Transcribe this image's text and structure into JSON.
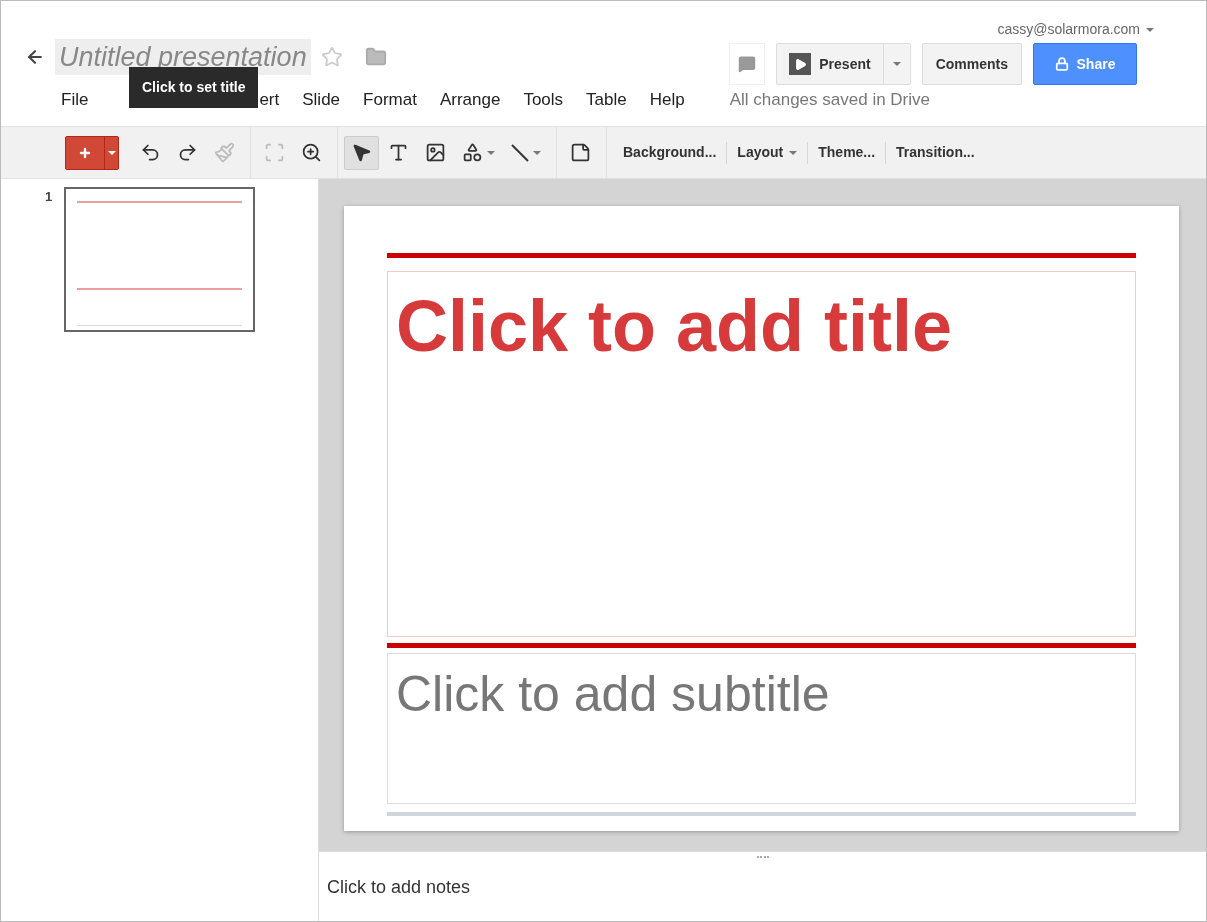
{
  "header": {
    "title": "Untitled presentation",
    "starred": false,
    "tooltip": "Click to set title",
    "account": "cassy@solarmora.com",
    "save_status": "All changes saved in Drive",
    "present": "Present",
    "comments": "Comments",
    "share": "Share"
  },
  "menu": [
    {
      "label": "File",
      "hidden_by_tooltip": false
    },
    {
      "label": "ert",
      "hidden_by_tooltip": true
    },
    {
      "label": "Slide",
      "hidden_by_tooltip": false
    },
    {
      "label": "Format",
      "hidden_by_tooltip": false
    },
    {
      "label": "Arrange",
      "hidden_by_tooltip": false
    },
    {
      "label": "Tools",
      "hidden_by_tooltip": false
    },
    {
      "label": "Table",
      "hidden_by_tooltip": false
    },
    {
      "label": "Help",
      "hidden_by_tooltip": false
    }
  ],
  "toolbar": {
    "tools": [
      {
        "kind": "undo",
        "selected": false,
        "disabled": false
      },
      {
        "kind": "redo",
        "selected": false,
        "disabled": false
      },
      {
        "kind": "paint",
        "selected": false,
        "disabled": true
      },
      {
        "kind": "fit",
        "selected": false,
        "disabled": true
      },
      {
        "kind": "zoom",
        "selected": false,
        "disabled": false
      },
      {
        "kind": "select",
        "selected": true,
        "disabled": false
      },
      {
        "kind": "textbox",
        "selected": false,
        "disabled": false
      },
      {
        "kind": "image",
        "selected": false,
        "disabled": false
      },
      {
        "kind": "shape",
        "selected": false,
        "disabled": false
      },
      {
        "kind": "line",
        "selected": false,
        "disabled": false
      },
      {
        "kind": "note",
        "selected": false,
        "disabled": false
      }
    ],
    "actions": [
      {
        "label": "Background...",
        "dropdown": false
      },
      {
        "label": "Layout",
        "dropdown": true
      },
      {
        "label": "Theme...",
        "dropdown": false
      },
      {
        "label": "Transition...",
        "dropdown": false
      }
    ]
  },
  "filmstrip": [
    {
      "number": "1",
      "selected": true
    }
  ],
  "slide": {
    "title_placeholder": "Click to add title",
    "subtitle_placeholder": "Click to add subtitle"
  },
  "notes": {
    "placeholder": "Click to add notes"
  }
}
